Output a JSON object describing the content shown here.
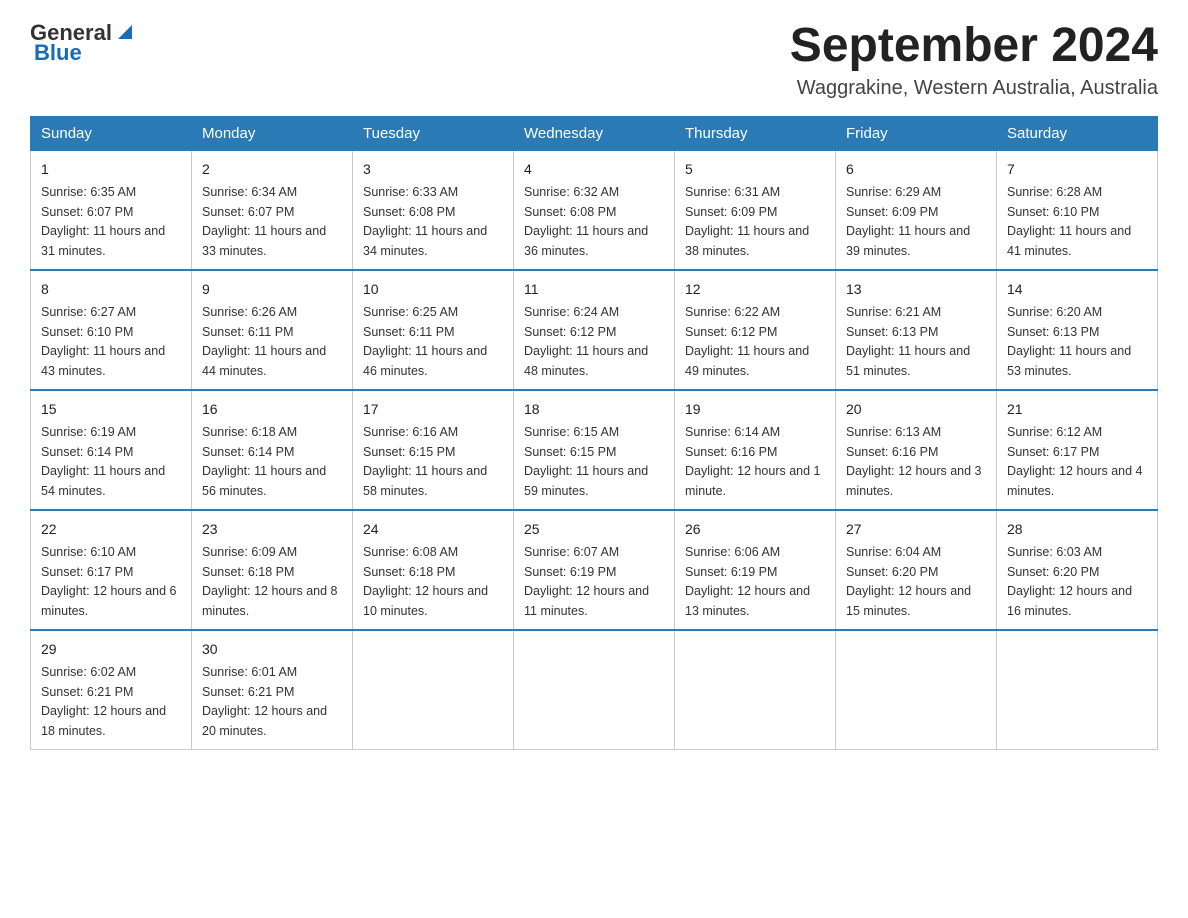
{
  "header": {
    "logo_general": "General",
    "logo_blue": "Blue",
    "month_title": "September 2024",
    "location": "Waggrakine, Western Australia, Australia"
  },
  "weekdays": [
    "Sunday",
    "Monday",
    "Tuesday",
    "Wednesday",
    "Thursday",
    "Friday",
    "Saturday"
  ],
  "weeks": [
    [
      {
        "day": "1",
        "sunrise": "6:35 AM",
        "sunset": "6:07 PM",
        "daylight": "11 hours and 31 minutes."
      },
      {
        "day": "2",
        "sunrise": "6:34 AM",
        "sunset": "6:07 PM",
        "daylight": "11 hours and 33 minutes."
      },
      {
        "day": "3",
        "sunrise": "6:33 AM",
        "sunset": "6:08 PM",
        "daylight": "11 hours and 34 minutes."
      },
      {
        "day": "4",
        "sunrise": "6:32 AM",
        "sunset": "6:08 PM",
        "daylight": "11 hours and 36 minutes."
      },
      {
        "day": "5",
        "sunrise": "6:31 AM",
        "sunset": "6:09 PM",
        "daylight": "11 hours and 38 minutes."
      },
      {
        "day": "6",
        "sunrise": "6:29 AM",
        "sunset": "6:09 PM",
        "daylight": "11 hours and 39 minutes."
      },
      {
        "day": "7",
        "sunrise": "6:28 AM",
        "sunset": "6:10 PM",
        "daylight": "11 hours and 41 minutes."
      }
    ],
    [
      {
        "day": "8",
        "sunrise": "6:27 AM",
        "sunset": "6:10 PM",
        "daylight": "11 hours and 43 minutes."
      },
      {
        "day": "9",
        "sunrise": "6:26 AM",
        "sunset": "6:11 PM",
        "daylight": "11 hours and 44 minutes."
      },
      {
        "day": "10",
        "sunrise": "6:25 AM",
        "sunset": "6:11 PM",
        "daylight": "11 hours and 46 minutes."
      },
      {
        "day": "11",
        "sunrise": "6:24 AM",
        "sunset": "6:12 PM",
        "daylight": "11 hours and 48 minutes."
      },
      {
        "day": "12",
        "sunrise": "6:22 AM",
        "sunset": "6:12 PM",
        "daylight": "11 hours and 49 minutes."
      },
      {
        "day": "13",
        "sunrise": "6:21 AM",
        "sunset": "6:13 PM",
        "daylight": "11 hours and 51 minutes."
      },
      {
        "day": "14",
        "sunrise": "6:20 AM",
        "sunset": "6:13 PM",
        "daylight": "11 hours and 53 minutes."
      }
    ],
    [
      {
        "day": "15",
        "sunrise": "6:19 AM",
        "sunset": "6:14 PM",
        "daylight": "11 hours and 54 minutes."
      },
      {
        "day": "16",
        "sunrise": "6:18 AM",
        "sunset": "6:14 PM",
        "daylight": "11 hours and 56 minutes."
      },
      {
        "day": "17",
        "sunrise": "6:16 AM",
        "sunset": "6:15 PM",
        "daylight": "11 hours and 58 minutes."
      },
      {
        "day": "18",
        "sunrise": "6:15 AM",
        "sunset": "6:15 PM",
        "daylight": "11 hours and 59 minutes."
      },
      {
        "day": "19",
        "sunrise": "6:14 AM",
        "sunset": "6:16 PM",
        "daylight": "12 hours and 1 minute."
      },
      {
        "day": "20",
        "sunrise": "6:13 AM",
        "sunset": "6:16 PM",
        "daylight": "12 hours and 3 minutes."
      },
      {
        "day": "21",
        "sunrise": "6:12 AM",
        "sunset": "6:17 PM",
        "daylight": "12 hours and 4 minutes."
      }
    ],
    [
      {
        "day": "22",
        "sunrise": "6:10 AM",
        "sunset": "6:17 PM",
        "daylight": "12 hours and 6 minutes."
      },
      {
        "day": "23",
        "sunrise": "6:09 AM",
        "sunset": "6:18 PM",
        "daylight": "12 hours and 8 minutes."
      },
      {
        "day": "24",
        "sunrise": "6:08 AM",
        "sunset": "6:18 PM",
        "daylight": "12 hours and 10 minutes."
      },
      {
        "day": "25",
        "sunrise": "6:07 AM",
        "sunset": "6:19 PM",
        "daylight": "12 hours and 11 minutes."
      },
      {
        "day": "26",
        "sunrise": "6:06 AM",
        "sunset": "6:19 PM",
        "daylight": "12 hours and 13 minutes."
      },
      {
        "day": "27",
        "sunrise": "6:04 AM",
        "sunset": "6:20 PM",
        "daylight": "12 hours and 15 minutes."
      },
      {
        "day": "28",
        "sunrise": "6:03 AM",
        "sunset": "6:20 PM",
        "daylight": "12 hours and 16 minutes."
      }
    ],
    [
      {
        "day": "29",
        "sunrise": "6:02 AM",
        "sunset": "6:21 PM",
        "daylight": "12 hours and 18 minutes."
      },
      {
        "day": "30",
        "sunrise": "6:01 AM",
        "sunset": "6:21 PM",
        "daylight": "12 hours and 20 minutes."
      },
      null,
      null,
      null,
      null,
      null
    ]
  ]
}
